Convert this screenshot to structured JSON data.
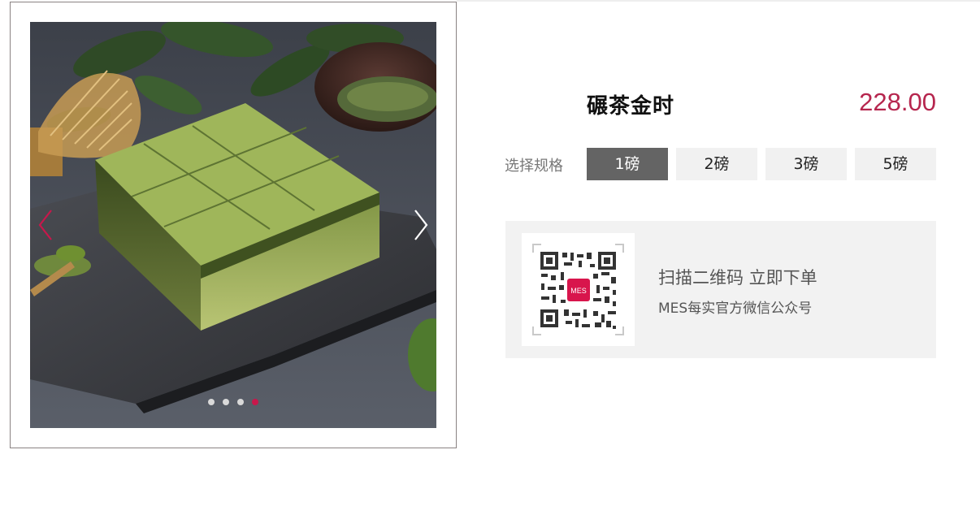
{
  "product": {
    "name": "碾茶金时",
    "price": "228.00"
  },
  "specs": {
    "label": "选择规格",
    "options": [
      "1磅",
      "2磅",
      "3磅",
      "5磅"
    ],
    "selected": "1磅"
  },
  "carousel": {
    "image": "matcha-cake-photo",
    "slide_count": 4,
    "active_slide": 4,
    "prev_icon": "chevron-left-icon",
    "next_icon": "chevron-right-icon"
  },
  "qr": {
    "line1": "扫描二维码 立即下单",
    "line2": "MES每实官方微信公众号",
    "logo_text": "MES"
  },
  "colors": {
    "accent": "#c8174b",
    "price": "#b6264e",
    "selected_spec_bg": "#646464",
    "panel_bg": "#f2f2f2"
  }
}
